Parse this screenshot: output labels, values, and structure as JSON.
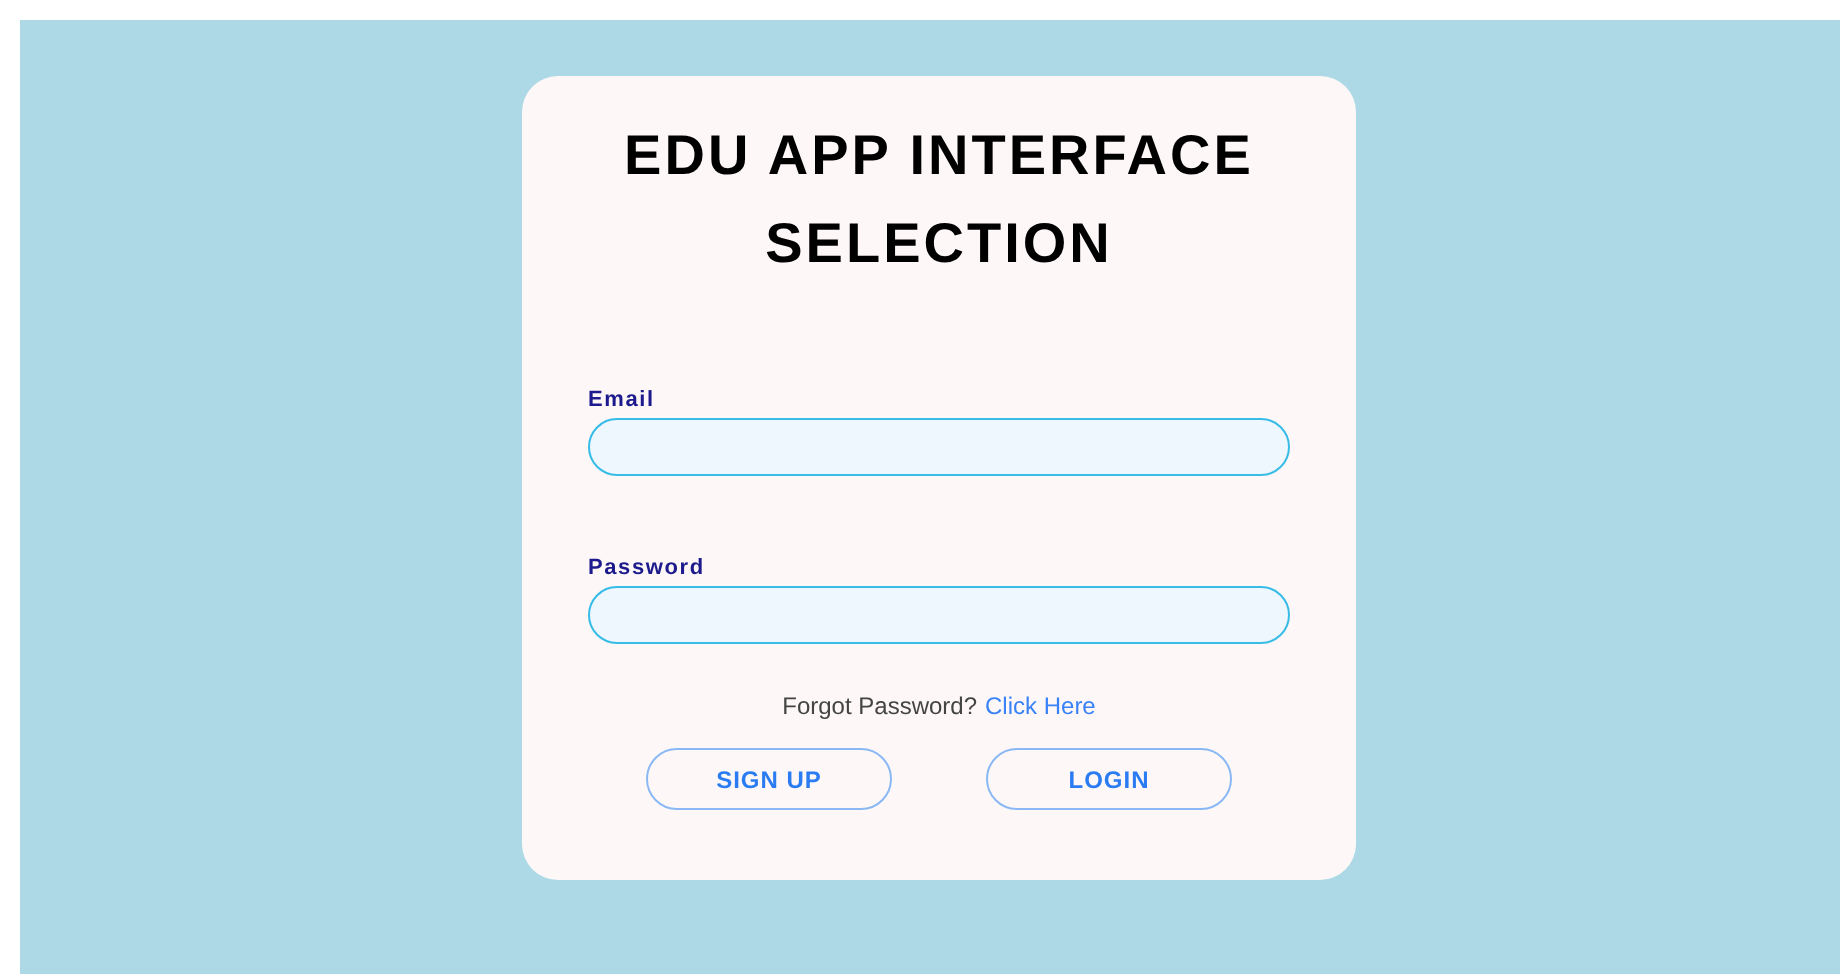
{
  "title": "EDU APP INTERFACE SELECTION",
  "fields": [
    {
      "label": "Email"
    },
    {
      "label": "Password"
    }
  ],
  "forgot": {
    "text": "Forgot Password?",
    "link": "Click Here"
  },
  "buttons": [
    {
      "label": "SIGN UP"
    },
    {
      "label": "LOGIN"
    }
  ]
}
